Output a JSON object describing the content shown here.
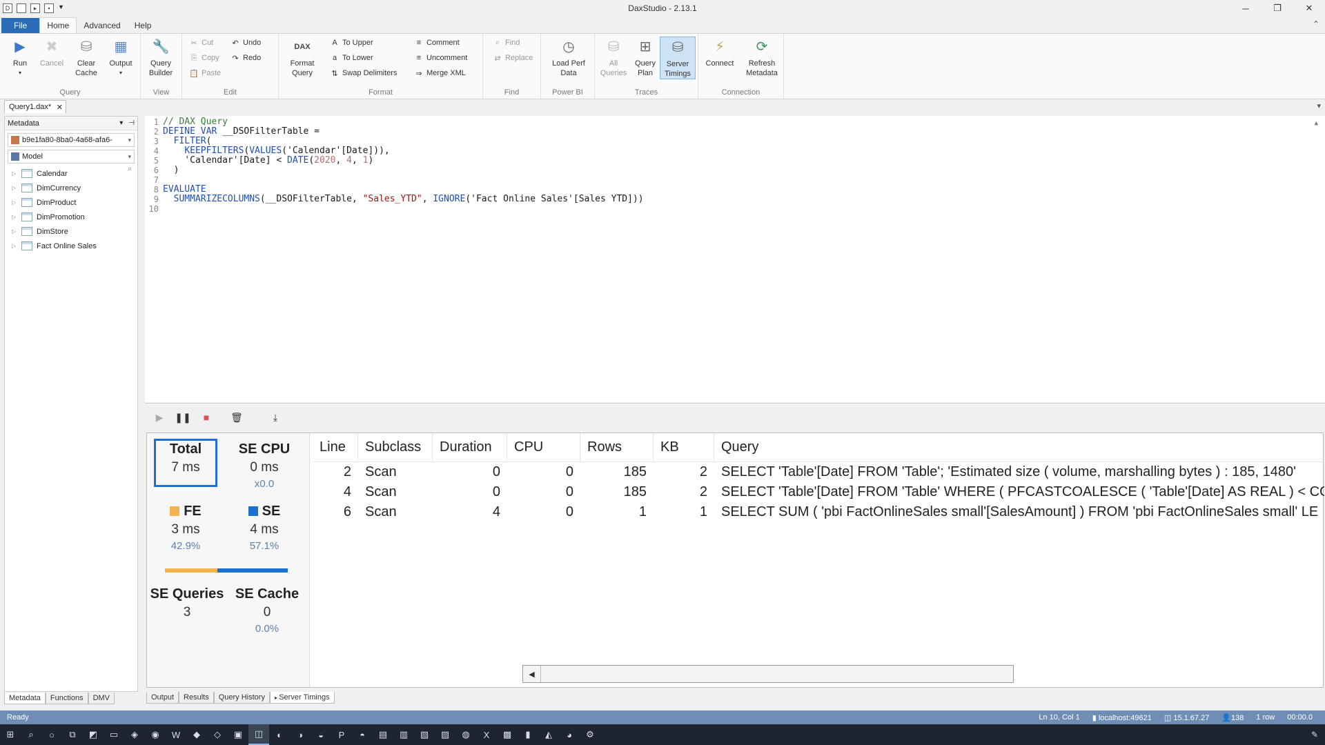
{
  "window": {
    "title": "DaxStudio - 2.13.1",
    "controls": {
      "minimize": "─",
      "restore": "❐",
      "close": "✕"
    }
  },
  "ribbon_tabs": [
    "File",
    "Home",
    "Advanced",
    "Help"
  ],
  "ribbon": {
    "groups": {
      "query": "Query",
      "view": "View",
      "edit": "Edit",
      "format": "Format",
      "find": "Find",
      "powerbi": "Power BI",
      "traces": "Traces",
      "connection": "Connection"
    },
    "run": "Run",
    "cancel": "Cancel",
    "clear_cache": "Clear\nCache",
    "output": "Output",
    "query_builder": "Query\nBuilder",
    "cut": "Cut",
    "copy": "Copy",
    "paste": "Paste",
    "undo": "Undo",
    "redo": "Redo",
    "format_query": "Format\nQuery",
    "format_query_logo": "DAX",
    "to_upper": "To Upper",
    "to_lower": "To Lower",
    "swap_delimiters": "Swap Delimiters",
    "comment": "Comment",
    "uncomment": "Uncomment",
    "merge_xml": "Merge XML",
    "find": "Find",
    "replace": "Replace",
    "load_perf_data": "Load Perf\nData",
    "all_queries": "All\nQueries",
    "query_plan": "Query\nPlan",
    "server_timings": "Server\nTimings",
    "connect": "Connect",
    "refresh_metadata": "Refresh\nMetadata"
  },
  "doc_tab": "Query1.dax*",
  "metadata": {
    "header": "Metadata",
    "database": "b9e1fa80-8ba0-4a68-afa6-",
    "model": "Model",
    "tables": [
      "Calendar",
      "DimCurrency",
      "DimProduct",
      "DimPromotion",
      "DimStore",
      "Fact Online Sales"
    ],
    "bottom_tabs": [
      "Metadata",
      "Functions",
      "DMV"
    ]
  },
  "editor": {
    "line_numbers": [
      "1",
      "2",
      "3",
      "4",
      "5",
      "6",
      "7",
      "8",
      "9",
      "10"
    ]
  },
  "server_timings": {
    "total_label": "Total",
    "total_value": "7 ms",
    "se_cpu_label": "SE CPU",
    "se_cpu_value": "0 ms",
    "se_cpu_ratio": "x0.0",
    "fe_label": "FE",
    "fe_value": "3 ms",
    "fe_pct": "42.9%",
    "se_label": "SE",
    "se_value": "4 ms",
    "se_pct": "57.1%",
    "fe_fraction": 0.429,
    "se_queries_label": "SE Queries",
    "se_queries_value": "3",
    "se_cache_label": "SE Cache",
    "se_cache_value": "0",
    "se_cache_pct": "0.0%",
    "colors": {
      "fe": "#f0b450",
      "se": "#1f6fd1"
    },
    "columns": [
      "Line",
      "Subclass",
      "Duration",
      "CPU",
      "Rows",
      "KB",
      "Query"
    ],
    "rows": [
      {
        "line": "2",
        "subclass": "Scan",
        "duration": "0",
        "cpu": "0",
        "rows": "185",
        "kb": "2",
        "query": "SELECT 'Table'[Date] FROM 'Table';   'Estimated size ( volume, marshalling bytes ) : 185, 1480'"
      },
      {
        "line": "4",
        "subclass": "Scan",
        "duration": "0",
        "cpu": "0",
        "rows": "185",
        "kb": "2",
        "query": "SELECT 'Table'[Date] FROM 'Table' WHERE  ( PFCASTCOALESCE ( 'Table'[Date] AS  REAL ) < COA"
      },
      {
        "line": "6",
        "subclass": "Scan",
        "duration": "4",
        "cpu": "0",
        "rows": "1",
        "kb": "1",
        "query": "SELECT SUM ( 'pbi FactOnlineSales small'[SalesAmount] ) FROM 'pbi FactOnlineSales small' LE"
      }
    ]
  },
  "bottom_tabs": [
    "Output",
    "Results",
    "Query History",
    "Server Timings"
  ],
  "status": {
    "ready": "Ready",
    "position": "Ln 10, Col 1",
    "server": "localhost:49621",
    "version": "15.1.67.27",
    "spid": "138",
    "rows": "1 row",
    "time": "00:00.0"
  }
}
